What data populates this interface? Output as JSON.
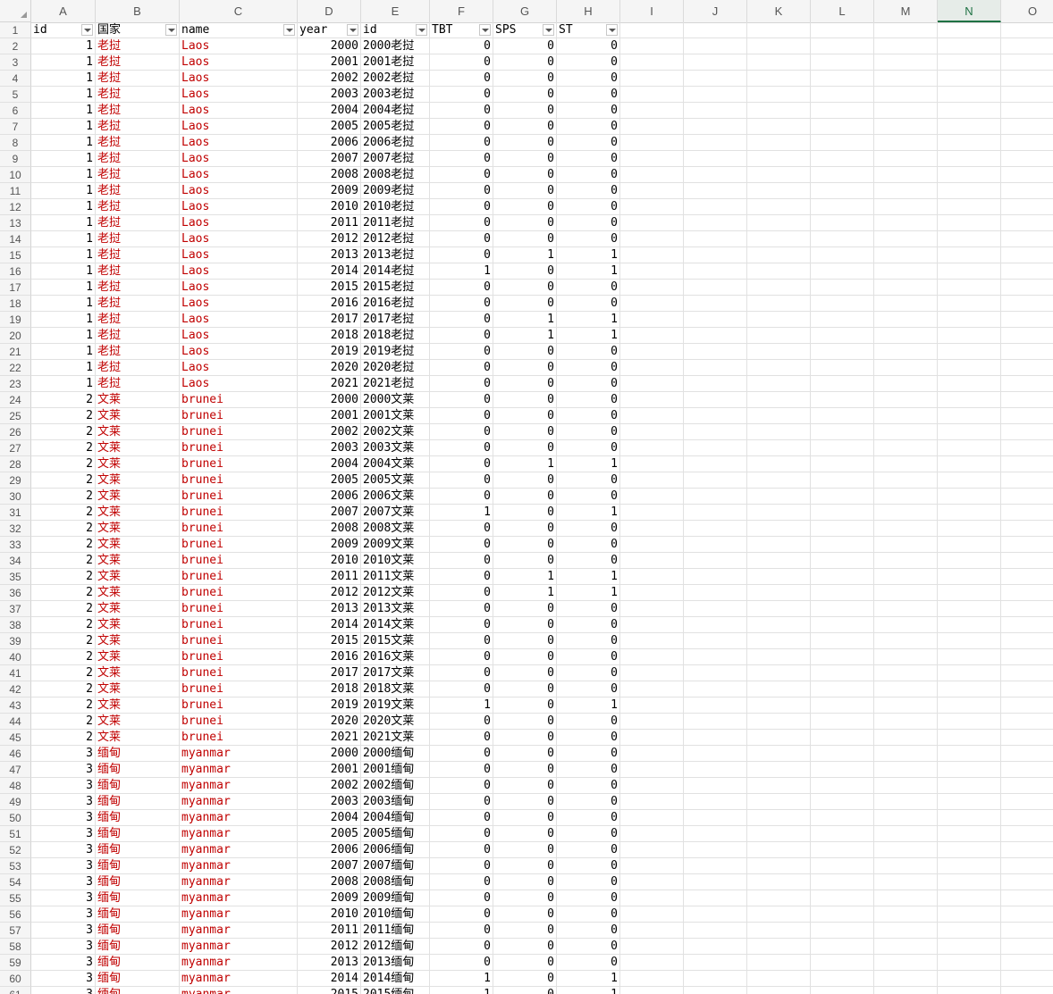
{
  "columns": [
    "A",
    "B",
    "C",
    "D",
    "E",
    "F",
    "G",
    "H",
    "I",
    "J",
    "K",
    "L",
    "M",
    "N",
    "O"
  ],
  "selected_column": "N",
  "header_row": [
    "id",
    "国家",
    "name",
    "year",
    "id",
    "TBT",
    "SPS",
    "ST"
  ],
  "countries": [
    {
      "id": "1",
      "cn": "老挝",
      "name": "Laos",
      "TBT": [
        0,
        0,
        0,
        0,
        0,
        0,
        0,
        0,
        0,
        0,
        0,
        0,
        0,
        0,
        1,
        0,
        0,
        0,
        0,
        0,
        0,
        0
      ],
      "SPS": [
        0,
        0,
        0,
        0,
        0,
        0,
        0,
        0,
        0,
        0,
        0,
        0,
        0,
        1,
        0,
        0,
        0,
        1,
        1,
        0,
        0,
        0
      ],
      "ST": [
        0,
        0,
        0,
        0,
        0,
        0,
        0,
        0,
        0,
        0,
        0,
        0,
        0,
        1,
        1,
        0,
        0,
        1,
        1,
        0,
        0,
        0
      ]
    },
    {
      "id": "2",
      "cn": "文莱",
      "name": "brunei",
      "TBT": [
        0,
        0,
        0,
        0,
        0,
        0,
        0,
        1,
        0,
        0,
        0,
        0,
        0,
        0,
        0,
        0,
        0,
        0,
        0,
        1,
        0,
        0
      ],
      "SPS": [
        0,
        0,
        0,
        0,
        1,
        0,
        0,
        0,
        0,
        0,
        0,
        1,
        1,
        0,
        0,
        0,
        0,
        0,
        0,
        0,
        0,
        0
      ],
      "ST": [
        0,
        0,
        0,
        0,
        1,
        0,
        0,
        1,
        0,
        0,
        0,
        1,
        1,
        0,
        0,
        0,
        0,
        0,
        0,
        1,
        0,
        0
      ]
    },
    {
      "id": "3",
      "cn": "缅甸",
      "name": "myanmar",
      "TBT": [
        0,
        0,
        0,
        0,
        0,
        0,
        0,
        0,
        0,
        0,
        0,
        0,
        0,
        0,
        1,
        1
      ],
      "SPS": [
        0,
        0,
        0,
        0,
        0,
        0,
        0,
        0,
        0,
        0,
        0,
        0,
        0,
        0,
        0,
        0
      ],
      "ST": [
        0,
        0,
        0,
        0,
        0,
        0,
        0,
        0,
        0,
        0,
        0,
        0,
        0,
        0,
        1,
        1
      ]
    }
  ],
  "year_start": 2000,
  "colors": {
    "text_red": "#c00000",
    "selected_header": "#1f7244"
  }
}
